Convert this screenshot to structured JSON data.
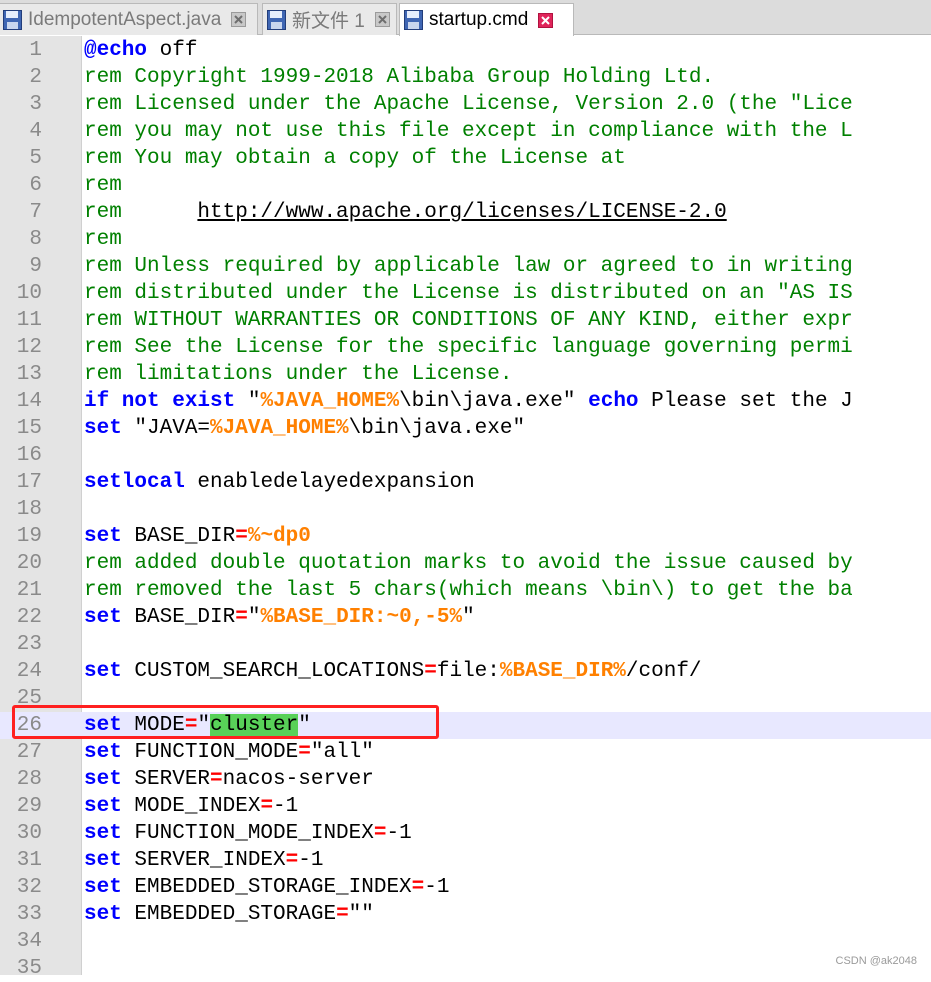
{
  "tabs": [
    {
      "label": "IdempotentAspect.java",
      "active": false
    },
    {
      "label": "新文件 1",
      "active": false
    },
    {
      "label": "startup.cmd",
      "active": true
    }
  ],
  "editor": {
    "current_line": 26,
    "lines": [
      [
        [
          "kw",
          "@echo"
        ],
        [
          "t",
          " off"
        ]
      ],
      [
        [
          "rem",
          "rem Copyright 1999-2018 Alibaba Group Holding Ltd."
        ]
      ],
      [
        [
          "rem",
          "rem Licensed under the Apache License, Version 2.0 (the \"Lice"
        ]
      ],
      [
        [
          "rem",
          "rem you may not use this file except in compliance with the L"
        ]
      ],
      [
        [
          "rem",
          "rem You may obtain a copy of the License at"
        ]
      ],
      [
        [
          "rem",
          "rem"
        ]
      ],
      [
        [
          "rem",
          "rem      "
        ],
        [
          "url",
          "http://www.apache.org/licenses/LICENSE-2.0"
        ]
      ],
      [
        [
          "rem",
          "rem"
        ]
      ],
      [
        [
          "rem",
          "rem Unless required by applicable law or agreed to in writing"
        ]
      ],
      [
        [
          "rem",
          "rem distributed under the License is distributed on an \"AS IS"
        ]
      ],
      [
        [
          "rem",
          "rem WITHOUT WARRANTIES OR CONDITIONS OF ANY KIND, either expr"
        ]
      ],
      [
        [
          "rem",
          "rem See the License for the specific language governing permi"
        ]
      ],
      [
        [
          "rem",
          "rem limitations under the License."
        ]
      ],
      [
        [
          "kw",
          "if not exist"
        ],
        [
          "t",
          " \""
        ],
        [
          "var",
          "%JAVA_HOME%"
        ],
        [
          "t",
          "\\bin\\java.exe\" "
        ],
        [
          "kw",
          "echo"
        ],
        [
          "t",
          " Please set the J"
        ]
      ],
      [
        [
          "kw",
          "set"
        ],
        [
          "t",
          " \"JAVA="
        ],
        [
          "var",
          "%JAVA_HOME%"
        ],
        [
          "t",
          "\\bin\\java.exe\""
        ]
      ],
      [],
      [
        [
          "kw",
          "setlocal"
        ],
        [
          "t",
          " enabledelayedexpansion"
        ]
      ],
      [],
      [
        [
          "kw",
          "set"
        ],
        [
          "t",
          " BASE_DIR"
        ],
        [
          "op",
          "="
        ],
        [
          "var",
          "%~dp0"
        ]
      ],
      [
        [
          "rem",
          "rem added double quotation marks to avoid the issue caused by"
        ]
      ],
      [
        [
          "rem",
          "rem removed the last 5 chars(which means \\bin\\) to get the ba"
        ]
      ],
      [
        [
          "kw",
          "set"
        ],
        [
          "t",
          " BASE_DIR"
        ],
        [
          "op",
          "="
        ],
        [
          "t",
          "\""
        ],
        [
          "var",
          "%BASE_DIR:~0,-5%"
        ],
        [
          "t",
          "\""
        ]
      ],
      [],
      [
        [
          "kw",
          "set"
        ],
        [
          "t",
          " CUSTOM_SEARCH_LOCATIONS"
        ],
        [
          "op",
          "="
        ],
        [
          "t",
          "file:"
        ],
        [
          "var",
          "%BASE_DIR%"
        ],
        [
          "t",
          "/conf/"
        ]
      ],
      [],
      [
        [
          "kw",
          "set"
        ],
        [
          "t",
          " MODE"
        ],
        [
          "op",
          "="
        ],
        [
          "t",
          "\""
        ],
        [
          "sel",
          "cluster"
        ],
        [
          "t",
          "\""
        ]
      ],
      [
        [
          "kw",
          "set"
        ],
        [
          "t",
          " FUNCTION_MODE"
        ],
        [
          "op",
          "="
        ],
        [
          "t",
          "\"all\""
        ]
      ],
      [
        [
          "kw",
          "set"
        ],
        [
          "t",
          " SERVER"
        ],
        [
          "op",
          "="
        ],
        [
          "t",
          "nacos-server"
        ]
      ],
      [
        [
          "kw",
          "set"
        ],
        [
          "t",
          " MODE_INDEX"
        ],
        [
          "op",
          "="
        ],
        [
          "t",
          "-1"
        ]
      ],
      [
        [
          "kw",
          "set"
        ],
        [
          "t",
          " FUNCTION_MODE_INDEX"
        ],
        [
          "op",
          "="
        ],
        [
          "t",
          "-1"
        ]
      ],
      [
        [
          "kw",
          "set"
        ],
        [
          "t",
          " SERVER_INDEX"
        ],
        [
          "op",
          "="
        ],
        [
          "t",
          "-1"
        ]
      ],
      [
        [
          "kw",
          "set"
        ],
        [
          "t",
          " EMBEDDED_STORAGE_INDEX"
        ],
        [
          "op",
          "="
        ],
        [
          "t",
          "-1"
        ]
      ],
      [
        [
          "kw",
          "set"
        ],
        [
          "t",
          " EMBEDDED_STORAGE"
        ],
        [
          "op",
          "="
        ],
        [
          "t",
          "\"\""
        ]
      ],
      [],
      []
    ]
  },
  "watermark": "CSDN @ak2048",
  "colors": {
    "keyword": "#0000ff",
    "comment": "#008000",
    "operator": "#ff0000",
    "variable": "#ff8000",
    "selection": "#58d158",
    "current_line": "#e8e8ff",
    "annotation_box": "#ff2020"
  }
}
